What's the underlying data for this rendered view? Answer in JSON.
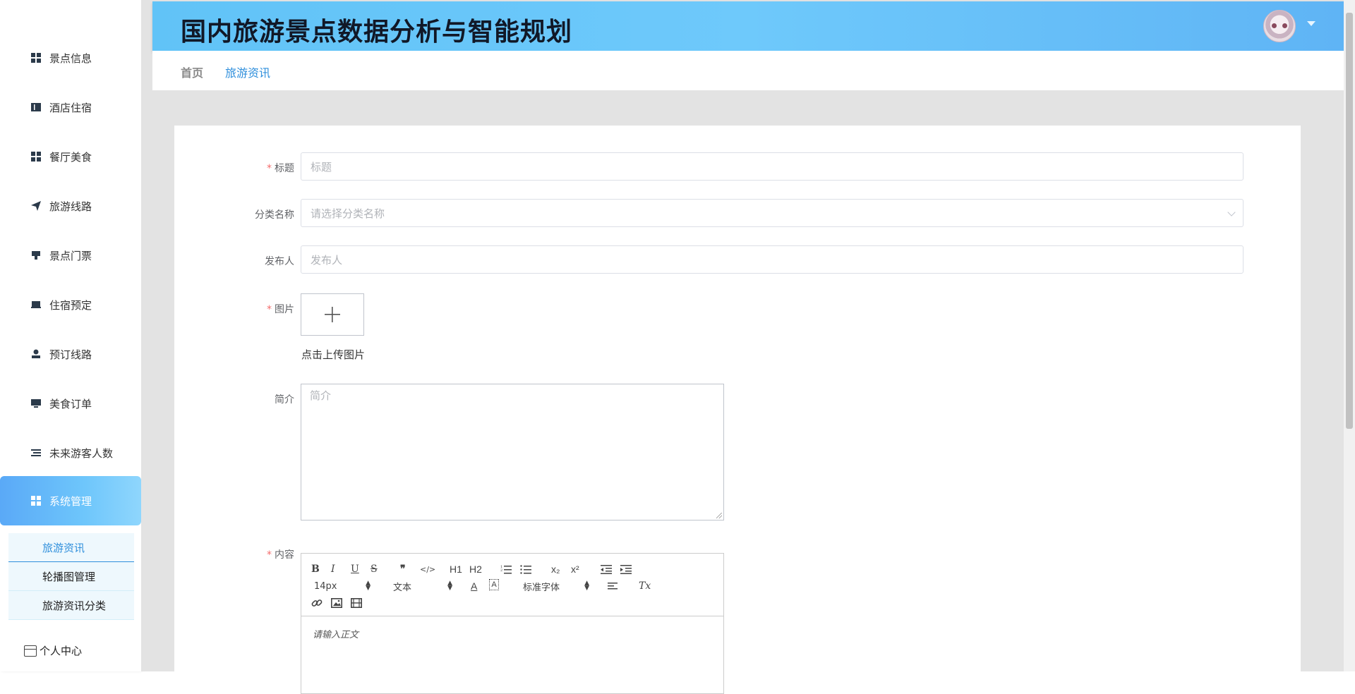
{
  "app": {
    "title": "国内旅游景点数据分析与智能规划"
  },
  "sidebar": {
    "items": [
      {
        "label": "景点信息",
        "icon": "grid-icon"
      },
      {
        "label": "酒店住宿",
        "icon": "book-icon"
      },
      {
        "label": "餐厅美食",
        "icon": "grid-icon"
      },
      {
        "label": "旅游线路",
        "icon": "send-icon"
      },
      {
        "label": "景点门票",
        "icon": "ticket-icon"
      },
      {
        "label": "住宿预定",
        "icon": "bed-icon"
      },
      {
        "label": "预订线路",
        "icon": "user-icon"
      },
      {
        "label": "美食订单",
        "icon": "monitor-icon"
      },
      {
        "label": "未来游客人数",
        "icon": "list-icon"
      },
      {
        "label": "系统管理",
        "icon": "grid-icon",
        "active": true
      }
    ],
    "submenu": [
      {
        "label": "旅游资讯",
        "active": true
      },
      {
        "label": "轮播图管理"
      },
      {
        "label": "旅游资讯分类"
      }
    ],
    "personal_center": "个人中心"
  },
  "breadcrumb": {
    "home": "首页",
    "current": "旅游资讯"
  },
  "form": {
    "title": {
      "label": "标题",
      "required": true,
      "placeholder": "标题"
    },
    "category": {
      "label": "分类名称",
      "placeholder": "请选择分类名称"
    },
    "publisher": {
      "label": "发布人",
      "placeholder": "发布人"
    },
    "image": {
      "label": "图片",
      "required": true,
      "hint": "点击上传图片"
    },
    "intro": {
      "label": "简介",
      "placeholder": "简介"
    },
    "content": {
      "label": "内容",
      "required": true,
      "placeholder": "请输入正文"
    }
  },
  "editor_toolbar": {
    "buttons_row1": [
      "B",
      "I",
      "U",
      "S",
      "❞",
      "</>",
      "H1",
      "H2",
      "ol",
      "ul",
      "x₂",
      "x²",
      "outdent",
      "indent"
    ],
    "font_size": "14px",
    "header_select": "文本",
    "font_family": "标准字体",
    "clear_format": "Tx"
  },
  "colors": {
    "accent": "#2f8fdc",
    "header_gradient_start": "#61c3f7",
    "required": "#f56c6c"
  }
}
